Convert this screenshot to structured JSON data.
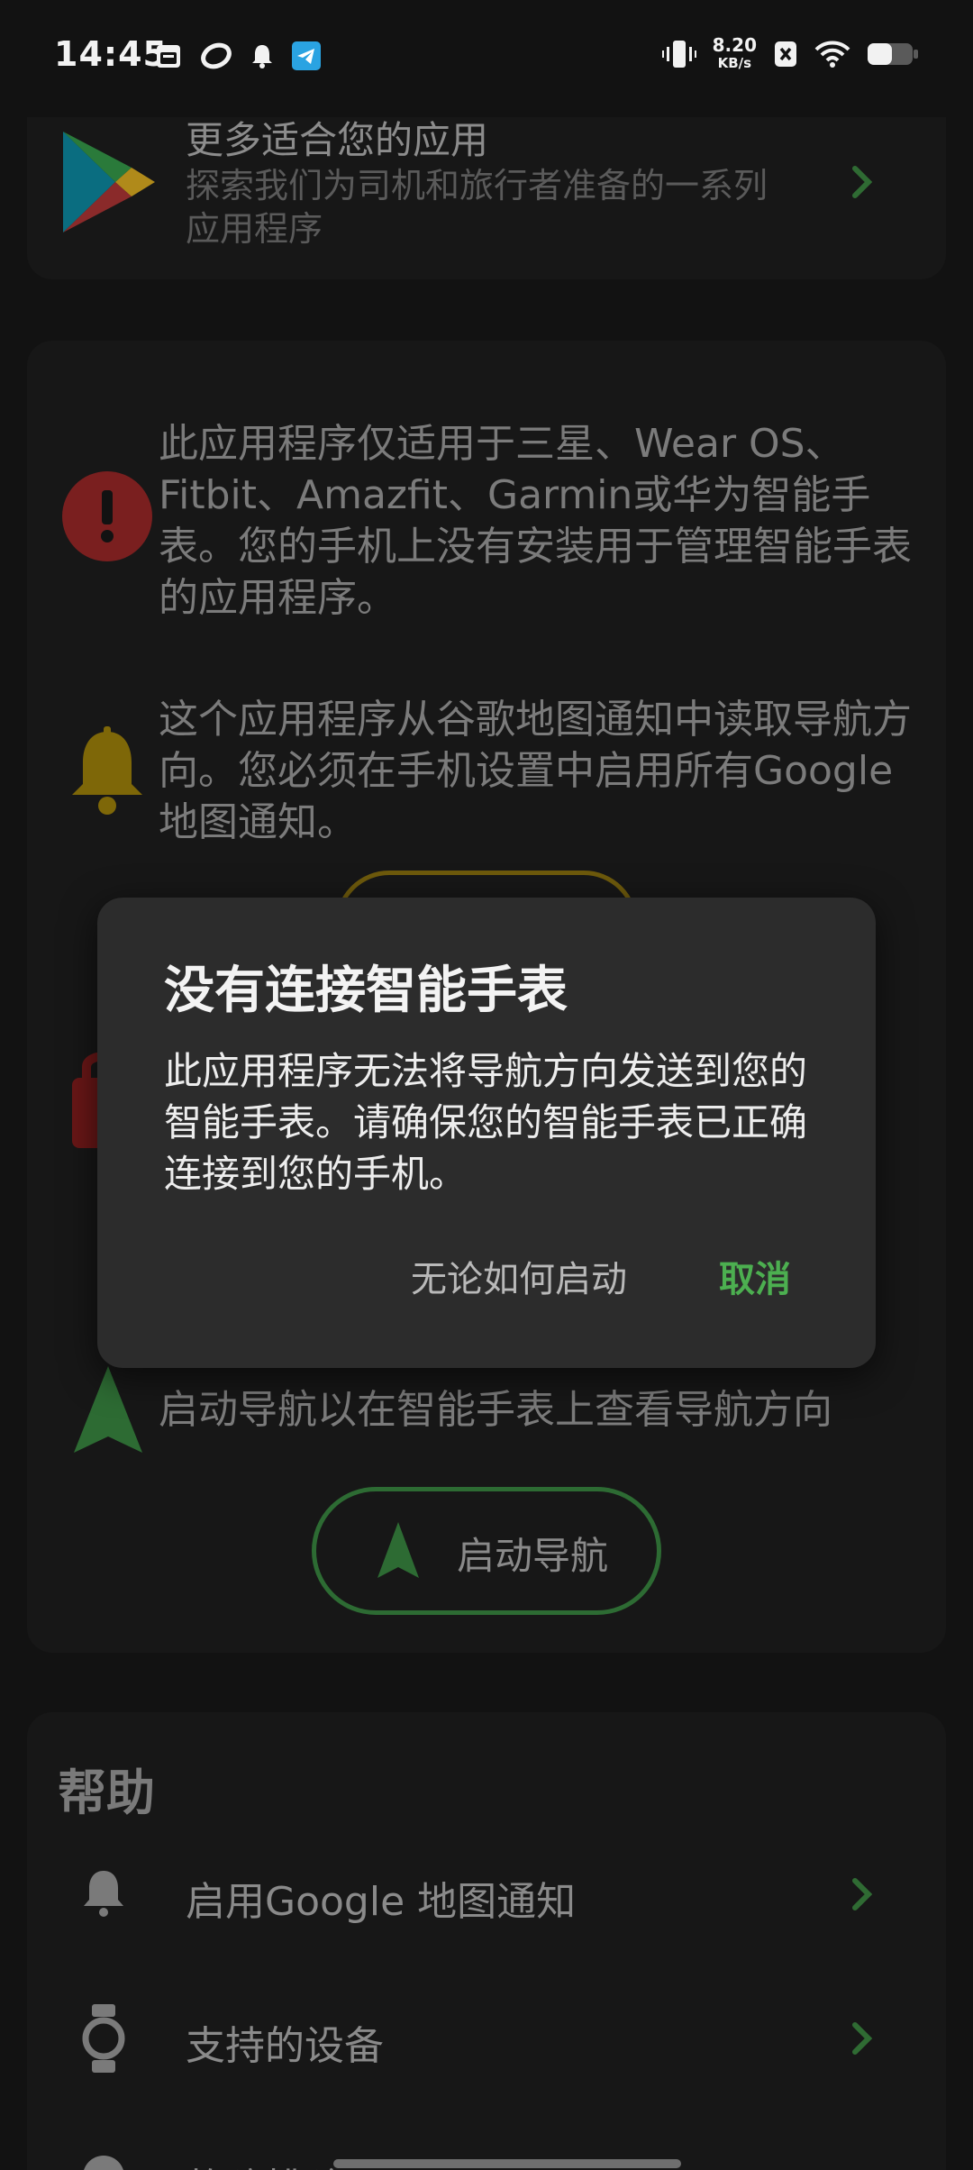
{
  "status_bar": {
    "time": "14:45",
    "net_speed_value": "8.20",
    "net_speed_unit": "KB/s",
    "icons": [
      "calendar-icon",
      "app-swirl-icon",
      "bell-icon",
      "telegram-icon",
      "vibrate-icon",
      "close-box-icon",
      "wifi-icon",
      "battery-icon"
    ]
  },
  "top_card": {
    "title": "更多适合您的应用",
    "subtitle": "探索我们为司机和旅行者准备的一系列应用程序",
    "icon": "play-store-icon"
  },
  "main_card": {
    "warning_text": "此应用程序仅适用于三星、Wear OS、Fitbit、Amazfit、Garmin或华为智能手表。您的手机上没有安装用于管理智能手表的应用程序。",
    "notification_text": "这个应用程序从谷歌地图通知中读取导航方向。您必须在手机设置中启用所有Google 地图通知。",
    "navigation_text": "启动导航以在智能手表上查看导航方向",
    "start_navigation_label": "启动导航"
  },
  "dialog": {
    "title": "没有连接智能手表",
    "body": "此应用程序无法将导航方向发送到您的智能手表。请确保您的智能手表已正确连接到您的手机。",
    "start_anyway_label": "无论如何启动",
    "cancel_label": "取消"
  },
  "help": {
    "heading": "帮助",
    "items": [
      {
        "label": "启用Google 地图通知",
        "icon": "bell-icon"
      },
      {
        "label": "支持的设备",
        "icon": "watch-icon"
      },
      {
        "label": "故障排除",
        "icon": "help-icon"
      }
    ]
  },
  "colors": {
    "accent_green": "#4caf50",
    "error_red": "#c62828",
    "bell_yellow": "#c9a10a",
    "background": "#121212"
  }
}
